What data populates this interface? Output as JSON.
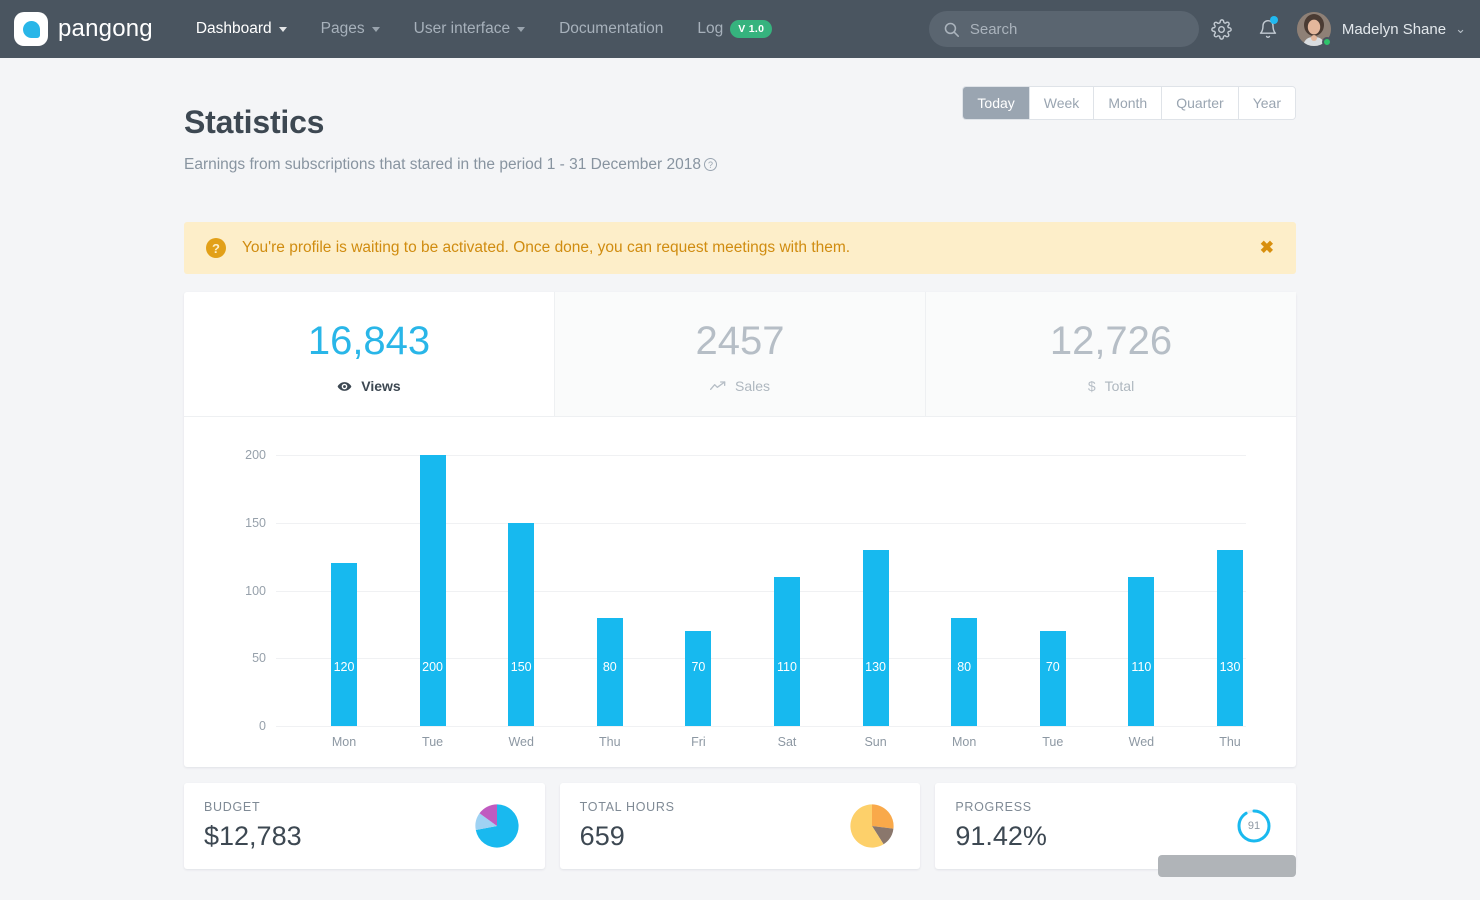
{
  "navbar": {
    "brand": "pangong",
    "logo_icon": "pangong-bubble-logo",
    "links": [
      {
        "label": "Dashboard",
        "has_caret": true,
        "active": true
      },
      {
        "label": "Pages",
        "has_caret": true,
        "active": false
      },
      {
        "label": "User interface",
        "has_caret": true,
        "active": false
      },
      {
        "label": "Documentation",
        "has_caret": false,
        "active": false
      },
      {
        "label": "Log",
        "has_caret": false,
        "active": false,
        "badge": "V 1.0"
      }
    ],
    "search_placeholder": "Search",
    "search_value": "",
    "search_icon": "search-icon",
    "settings_icon": "gear-icon",
    "notifications_icon": "bell-icon",
    "user_name": "Madelyn Shane",
    "brand_color": "#29b6e8",
    "nav_bg": "#4a5560",
    "badge_color": "#36b37e"
  },
  "header": {
    "title": "Statistics",
    "subtitle": "Earnings from subscriptions that stared in the period 1 - 31 December 2018",
    "help_icon": "question-mark-icon",
    "periods": [
      {
        "label": "Today",
        "active": true
      },
      {
        "label": "Week",
        "active": false
      },
      {
        "label": "Month",
        "active": false
      },
      {
        "label": "Quarter",
        "active": false
      },
      {
        "label": "Year",
        "active": false
      }
    ]
  },
  "alert": {
    "icon": "question-circle-icon",
    "message": "You're profile is waiting to be activated. Once done, you can request meetings with them.",
    "close_label": "✖",
    "bg_color": "#fdeec9",
    "text_color": "#d08c10"
  },
  "stats": [
    {
      "value": "16,843",
      "label": "Views",
      "icon": "eye-icon",
      "highlight": true
    },
    {
      "value": "2457",
      "label": "Sales",
      "icon": "trending-up-icon",
      "highlight": false
    },
    {
      "value": "12,726",
      "label": "Total",
      "icon": "dollar-icon",
      "highlight": false
    }
  ],
  "chart_data": {
    "type": "bar",
    "title": "",
    "xlabel": "",
    "ylabel": "",
    "categories": [
      "Mon",
      "Tue",
      "Wed",
      "Thu",
      "Fri",
      "Sat",
      "Sun",
      "Mon",
      "Tue",
      "Wed",
      "Thu"
    ],
    "values": [
      120,
      200,
      150,
      80,
      70,
      110,
      130,
      80,
      70,
      110,
      130
    ],
    "yticks": [
      0,
      50,
      100,
      150,
      200
    ],
    "ylim": [
      0,
      200
    ],
    "grid": true,
    "legend": false,
    "bar_color": "#17b9ef",
    "data_labels": true
  },
  "bottom_cards": [
    {
      "label": "BUDGET",
      "value": "$12,783",
      "visual": "pie-chart",
      "slices": [
        {
          "value": 72,
          "color": "#19b9ef"
        },
        {
          "value": 13,
          "color": "#9fd2f3"
        },
        {
          "value": 15,
          "color": "#c05bc0"
        }
      ]
    },
    {
      "label": "TOTAL HOURS",
      "value": "659",
      "visual": "pie-chart",
      "slices": [
        {
          "value": 27,
          "color": "#f9a94a"
        },
        {
          "value": 14,
          "color": "#8a776c"
        },
        {
          "value": 59,
          "color": "#fdd06a"
        }
      ]
    },
    {
      "label": "PROGRESS",
      "value": "91.42%",
      "visual": "progress-ring",
      "ring_value": "91",
      "ring_percent": 91,
      "ring_color": "#19b9ef"
    }
  ]
}
